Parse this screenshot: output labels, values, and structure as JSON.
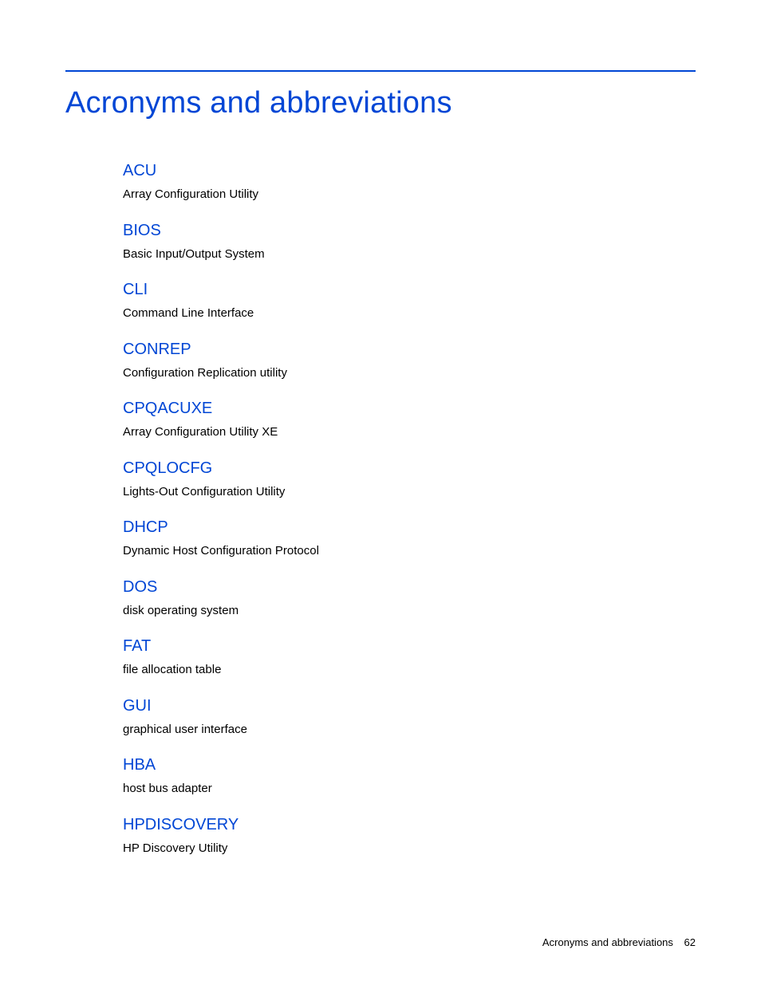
{
  "title": "Acronyms and abbreviations",
  "entries": [
    {
      "term": "ACU",
      "def": "Array Configuration Utility"
    },
    {
      "term": "BIOS",
      "def": "Basic Input/Output System"
    },
    {
      "term": "CLI",
      "def": "Command Line Interface"
    },
    {
      "term": "CONREP",
      "def": "Configuration Replication utility"
    },
    {
      "term": "CPQACUXE",
      "def": "Array Configuration Utility XE"
    },
    {
      "term": "CPQLOCFG",
      "def": "Lights-Out Configuration Utility"
    },
    {
      "term": "DHCP",
      "def": "Dynamic Host Configuration Protocol"
    },
    {
      "term": "DOS",
      "def": "disk operating system"
    },
    {
      "term": "FAT",
      "def": "file allocation table"
    },
    {
      "term": "GUI",
      "def": "graphical user interface"
    },
    {
      "term": "HBA",
      "def": "host bus adapter"
    },
    {
      "term": "HPDISCOVERY",
      "def": "HP Discovery Utility"
    }
  ],
  "footer": {
    "section": "Acronyms and abbreviations",
    "page": "62"
  }
}
